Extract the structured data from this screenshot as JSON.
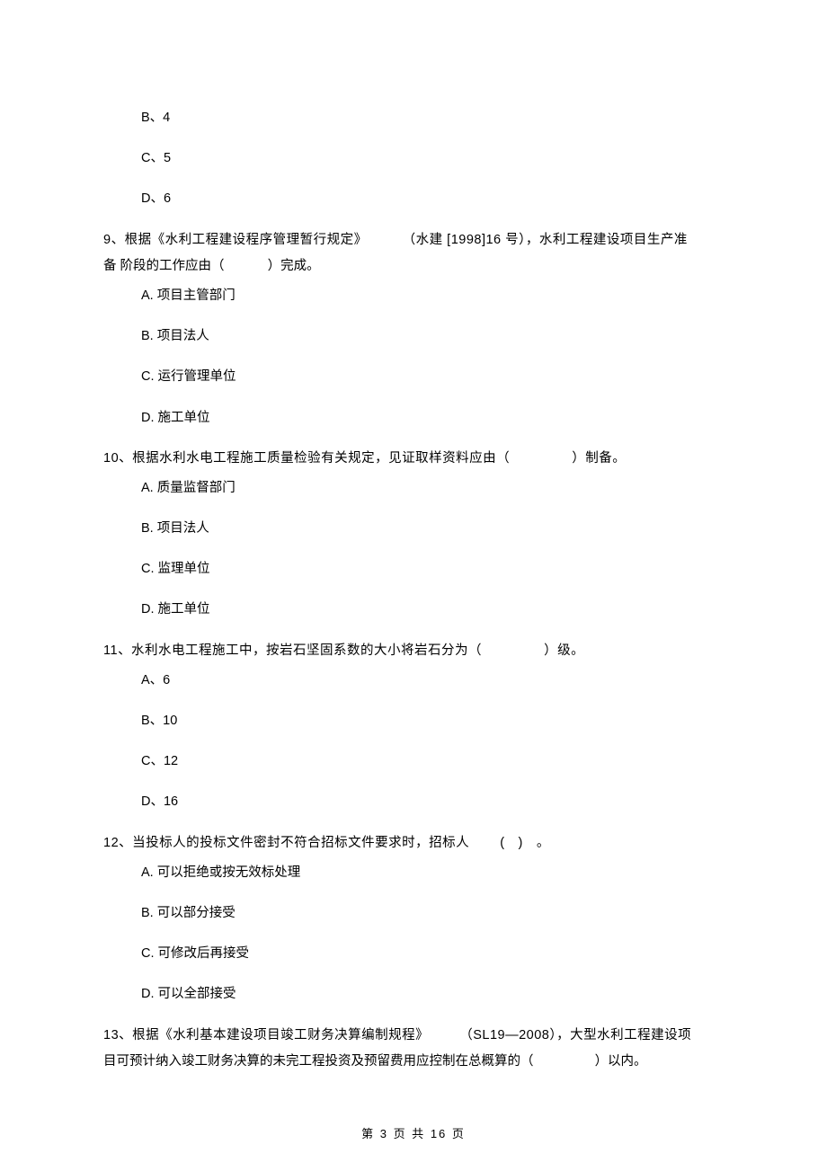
{
  "orphan_options": {
    "b": "B、4",
    "c": "C、5",
    "d": "D、6"
  },
  "q9": {
    "number": "9",
    "text_pre": "、根据《水利工程建设程序管理暂行规定》",
    "text_ref": "（水建 [1998]16 号），水利工程建设项目生产准",
    "text_line2_pre": "备 阶段的工作应由（",
    "text_line2_post": "）完成。",
    "a": "A. 项目主管部门",
    "b": "B. 项目法人",
    "c": "C. 运行管理单位",
    "d": "D. 施工单位"
  },
  "q10": {
    "number": "10",
    "text_pre": "、根据水利水电工程施工质量检验有关规定，见证取样资料应由（",
    "text_post": "）制备。",
    "a": "A.  质量监督部门",
    "b": "B.  项目法人",
    "c": "C.  监理单位",
    "d": "D.  施工单位"
  },
  "q11": {
    "number": "11",
    "text_pre": "、水利水电工程施工中，按岩石坚固系数的大小将岩石分为（",
    "text_post": "）级。",
    "a": "A、6",
    "b": "B、10",
    "c": "C、12",
    "d": "D、16"
  },
  "q12": {
    "number": "12",
    "text_pre": "、当投标人的投标文件密封不符合招标文件要求时，招标人",
    "text_post": "(　)　。",
    "a": "A.  可以拒绝或按无效标处理",
    "b": "B.  可以部分接受",
    "c": "C.  可修改后再接受",
    "d": "D.  可以全部接受"
  },
  "q13": {
    "number": "13",
    "text_pre": "、根据《水利基本建设项目竣工财务决算编制规程》",
    "text_ref": "（SL19—2008），大型水利工程建设项",
    "text_line2_pre": "目可预计纳入竣工财务决算的未完工程投资及预留费用应控制在总概算的（",
    "text_line2_post": "）以内。"
  },
  "footer": {
    "pre": "第",
    "cur": "3",
    "mid": "页 共",
    "total": "16",
    "post": "页"
  }
}
